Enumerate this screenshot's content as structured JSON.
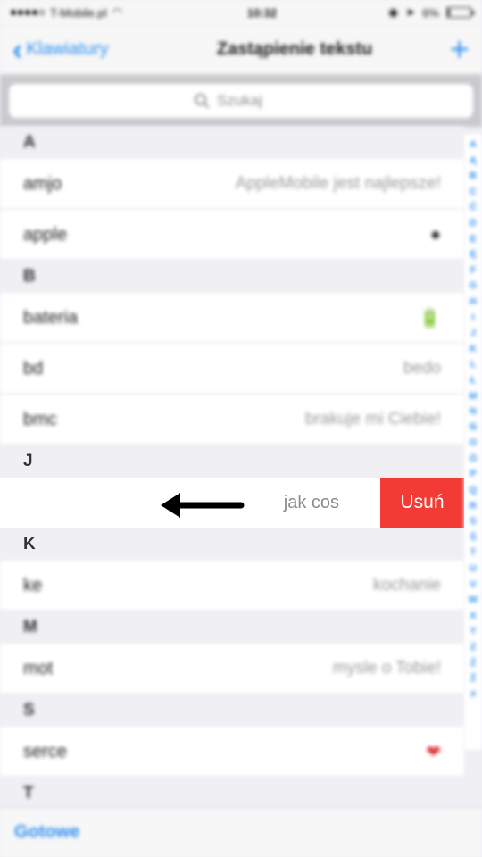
{
  "status_bar": {
    "carrier": "T-Mobile.pl",
    "time": "10:32",
    "battery": "6%"
  },
  "nav": {
    "back_label": "Klawiatury",
    "title": "Zastąpienie tekstu"
  },
  "search": {
    "placeholder": "Szukaj"
  },
  "sections": [
    {
      "letter": "A",
      "rows": [
        {
          "shortcut": "amjo",
          "phrase": "AppleMobile jest najlepsze!"
        },
        {
          "shortcut": "apple",
          "phrase": "",
          "emoji": ""
        }
      ]
    },
    {
      "letter": "B",
      "rows": [
        {
          "shortcut": "bateria",
          "phrase": "",
          "emoji": "🔋"
        },
        {
          "shortcut": "bd",
          "phrase": "bedo"
        },
        {
          "shortcut": "bmc",
          "phrase": "brakuje mi Ciebie!"
        }
      ]
    },
    {
      "letter": "J",
      "rows": [
        {
          "phrase": "jak cos",
          "delete_label": "Usuń"
        }
      ]
    },
    {
      "letter": "K",
      "rows": [
        {
          "shortcut": "ke",
          "phrase": "kochanie"
        }
      ]
    },
    {
      "letter": "M",
      "rows": [
        {
          "shortcut": "mot",
          "phrase": "mysle o Tobie!"
        }
      ]
    },
    {
      "letter": "S",
      "rows": [
        {
          "shortcut": "serce",
          "emoji": "❤"
        }
      ]
    },
    {
      "letter": "T",
      "rows": []
    }
  ],
  "index_letters": [
    "A",
    "Ą",
    "B",
    "C",
    "Ć",
    "D",
    "E",
    "Ę",
    "F",
    "G",
    "H",
    "I",
    "J",
    "K",
    "L",
    "Ł",
    "M",
    "N",
    "Ń",
    "O",
    "Ó",
    "P",
    "Q",
    "R",
    "S",
    "Ś",
    "T",
    "U",
    "V",
    "W",
    "X",
    "Y",
    "Z",
    "Ź",
    "Ż",
    "#"
  ],
  "toolbar": {
    "done_label": "Gotowe"
  },
  "colors": {
    "accent": "#2f8ff0",
    "delete": "#f23b35"
  }
}
